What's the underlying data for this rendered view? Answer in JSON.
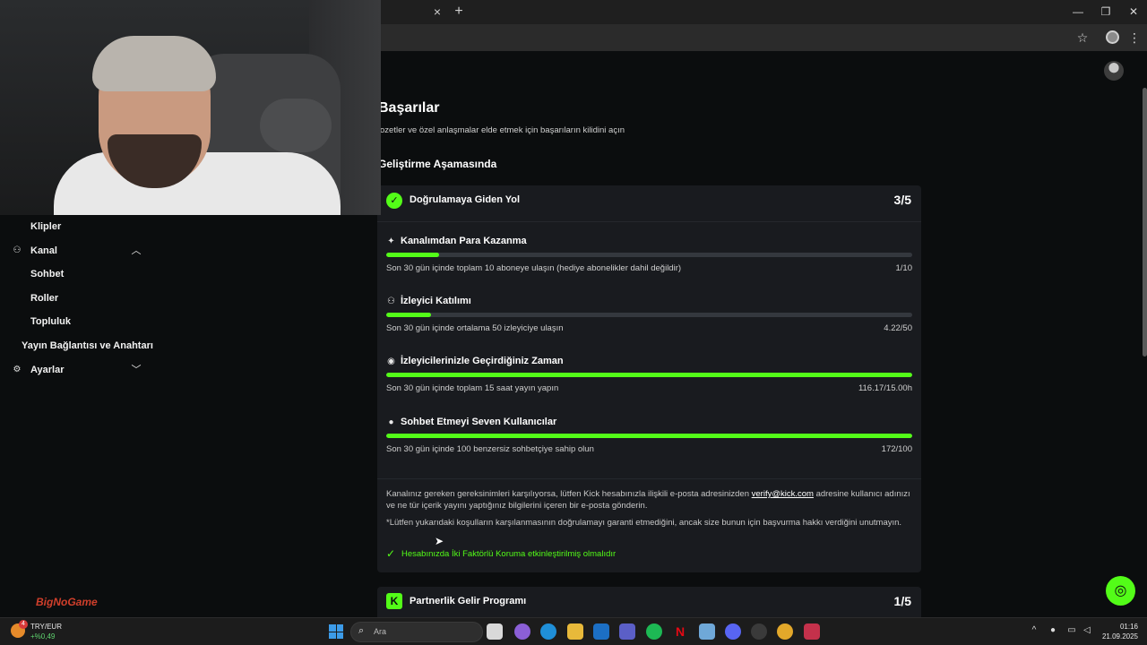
{
  "browser": {
    "tab_close": "×",
    "tab_new": "+",
    "minimize": "—",
    "restore": "❐",
    "close": "✕",
    "star": "☆",
    "menu": "⋮"
  },
  "page": {
    "title": "Başarılar",
    "subtitle": "ozetler ve özel anlaşmalar elde etmek için başarıların kilidini açın",
    "section_title": "Geliştirme Aşamasında"
  },
  "card": {
    "title": "Doğrulamaya Giden Yol",
    "count": "3/5",
    "tasks": [
      {
        "title": "Kanalımdan Para Kazanma",
        "description": "Son 30 gün içinde toplam 10 aboneye ulaşın (hediye abonelikler dahil değildir)",
        "progress": "1/10",
        "fraction": 0.1,
        "icon": "sparkle-icon"
      },
      {
        "title": "İzleyici Katılımı",
        "description": "Son 30 gün içinde ortalama 50 izleyiciye ulaşın",
        "progress": "4.22/50",
        "fraction": 0.0844,
        "icon": "users-icon"
      },
      {
        "title": "İzleyicilerinizle Geçirdiğiniz Zaman",
        "description": "Son 30 gün içinde toplam 15 saat yayın yapın",
        "progress": "116.17/15.00h",
        "fraction": 1.0,
        "icon": "broadcast-icon"
      },
      {
        "title": "Sohbet Etmeyi Seven Kullanıcılar",
        "description": "Son 30 gün içinde 100 benzersiz sohbetçiye sahip olun",
        "progress": "172/100",
        "fraction": 1.0,
        "icon": "chat-icon"
      }
    ],
    "info_1_before": "Kanalınız gereken gereksinimleri karşılıyorsa, lütfen Kick hesabınızla ilişkili e-posta adresinizden ",
    "info_1_link": "verify@kick.com",
    "info_1_after": " adresine kullanıcı adınızı ve ne tür içerik yayını yaptığınız bilgilerini içeren bir e-posta gönderin.",
    "info_2": "*Lütfen yukarıdaki koşulların karşılanmasının doğrulamayı garanti etmediğini, ancak size bunun için başvurma hakkı verdiğini unutmayın.",
    "check_text": "Hesabınızda İki Faktörlü Koruma etkinleştirilmiş olmalıdır"
  },
  "card2": {
    "title": "Partnerlik Gelir Programı",
    "count": "1/5"
  },
  "sidebar": {
    "clips": "Klipler",
    "channel": "Kanal",
    "chat": "Sohbet",
    "roles": "Roller",
    "community": "Topluluk",
    "stream_key": "Yayın Bağlantısı ve Anahtarı",
    "settings": "Ayarlar"
  },
  "watermark": "BigNoGame",
  "taskbar": {
    "ticker": "TRY/EUR",
    "ticker_change": "+%0,49",
    "badge": "4",
    "search_placeholder": "Ara",
    "time": "01:16",
    "date": "21.09.2025"
  },
  "colors": {
    "accent": "#53fc18",
    "card_bg": "#191b1f",
    "page_bg": "#0b0d0e",
    "track": "#34383e"
  }
}
